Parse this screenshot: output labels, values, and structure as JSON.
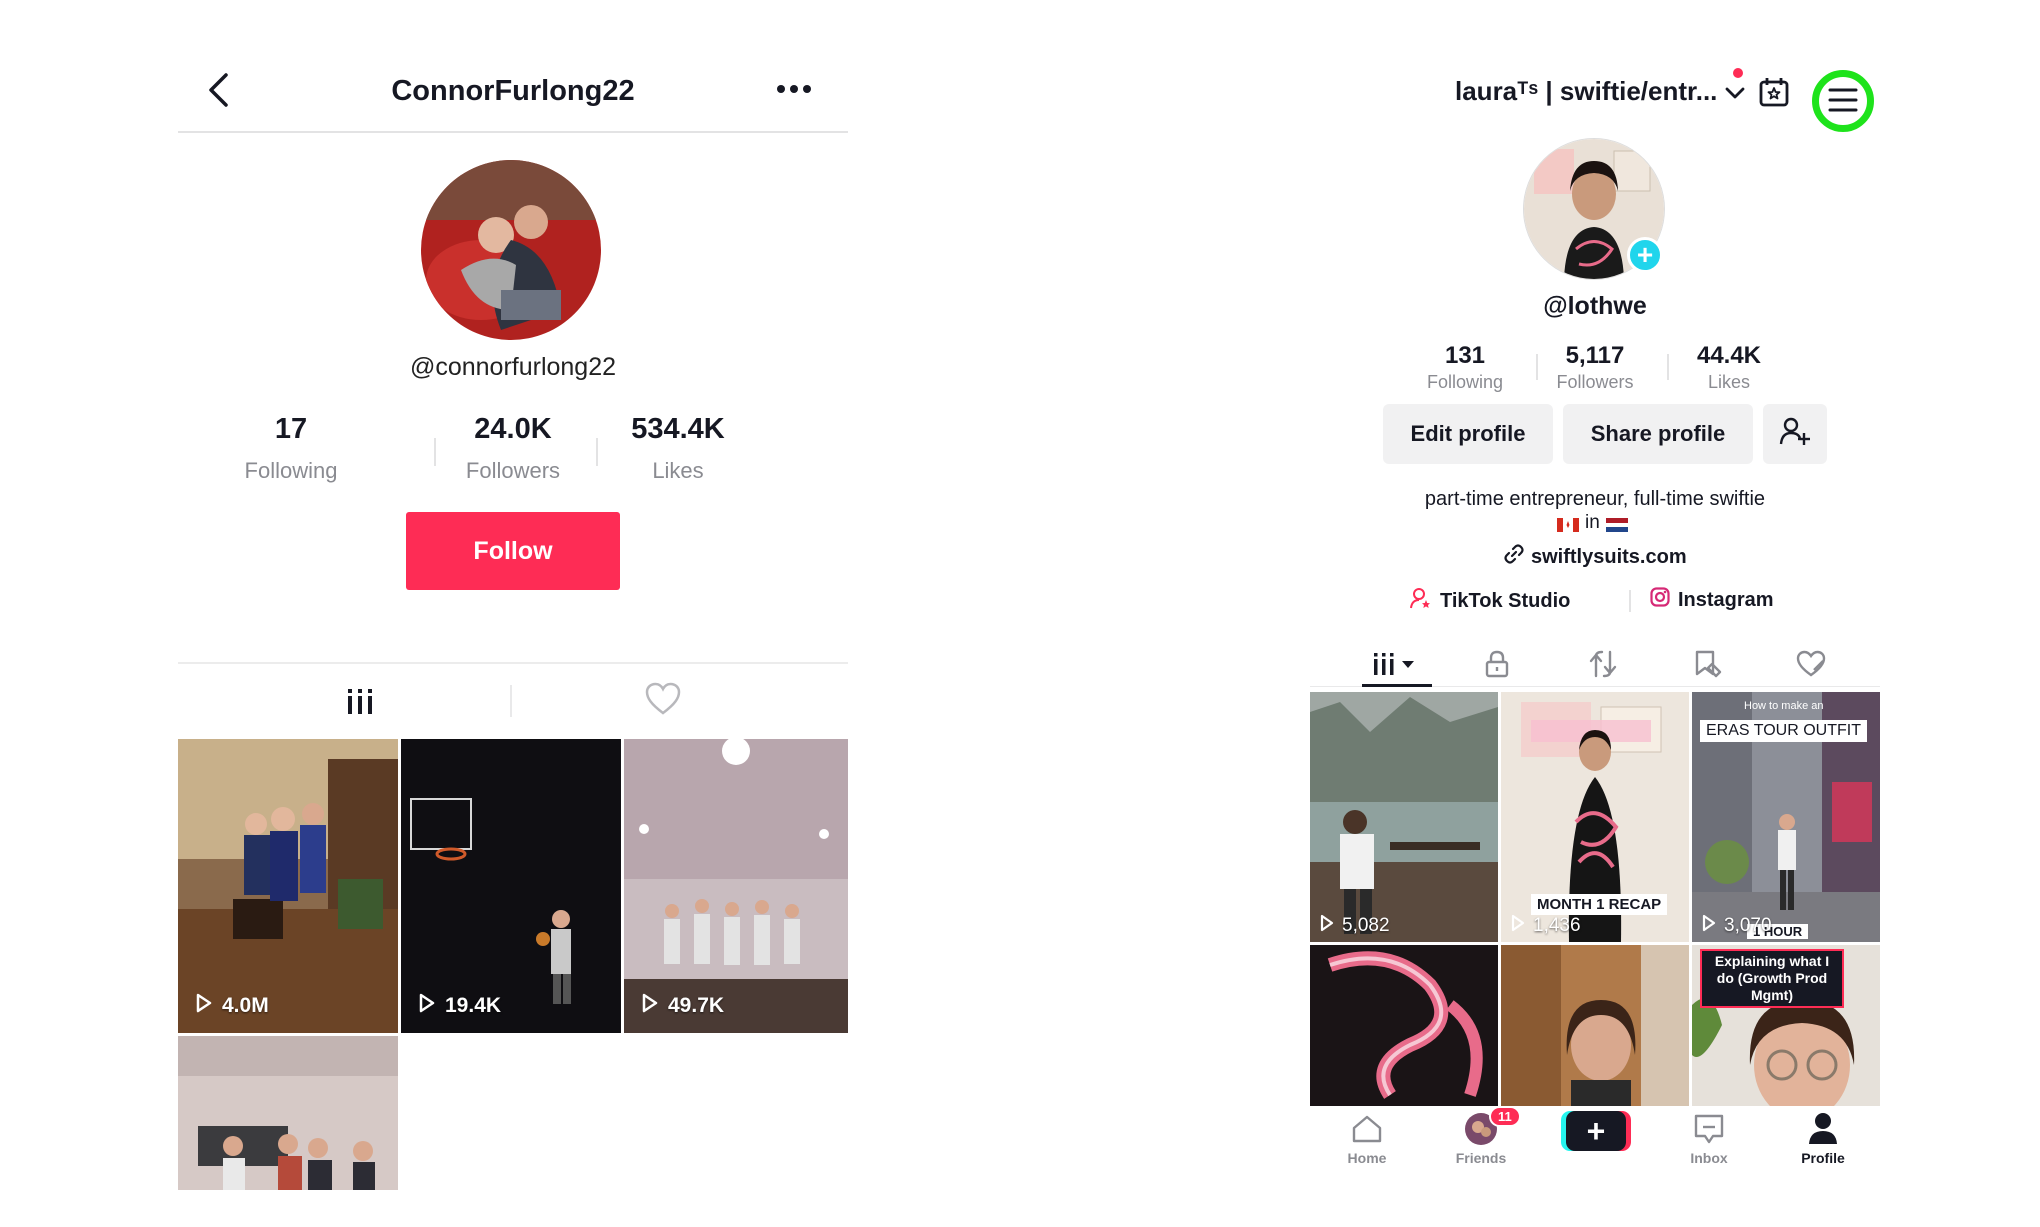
{
  "left_profile": {
    "title": "ConnorFurlong22",
    "handle": "@connorfurlong22",
    "stats": [
      {
        "value": "17",
        "label": "Following"
      },
      {
        "value": "24.0K",
        "label": "Followers"
      },
      {
        "value": "534.4K",
        "label": "Likes"
      }
    ],
    "follow_label": "Follow",
    "tabs": [
      {
        "icon": "grid-icon"
      },
      {
        "icon": "heart-outline-icon"
      }
    ],
    "videos": [
      {
        "views": "4.0M"
      },
      {
        "views": "19.4K"
      },
      {
        "views": "49.7K"
      },
      {
        "views": ""
      }
    ]
  },
  "right_profile": {
    "account_name": "lauraᵀˢ | swiftie/entr...",
    "handle": "@lothwe",
    "stats": [
      {
        "value": "131",
        "label": "Following"
      },
      {
        "value": "5,117",
        "label": "Followers"
      },
      {
        "value": "44.4K",
        "label": "Likes"
      }
    ],
    "buttons": {
      "edit": "Edit profile",
      "share": "Share profile"
    },
    "bio": "part-time entrepreneur, full-time swiftie",
    "bio_line2": "in",
    "link": "swiftlysuits.com",
    "extra_links": [
      "TikTok Studio",
      "Instagram"
    ],
    "videos": [
      {
        "views": "5,082",
        "caption": ""
      },
      {
        "views": "1,436",
        "caption": "MONTH 1 RECAP"
      },
      {
        "views": "3,070",
        "caption": "ERAS TOUR OUTFIT",
        "caption_small": "How to make an",
        "caption_bottom": "1 HOUR"
      },
      {
        "views": "",
        "caption": ""
      },
      {
        "views": "",
        "caption": ""
      },
      {
        "views": "",
        "caption": "Explaining what I do (Growth Prod Mgmt)"
      }
    ],
    "nav": {
      "home": "Home",
      "friends": "Friends",
      "friends_badge": "11",
      "inbox": "Inbox",
      "profile": "Profile"
    },
    "colors": {
      "highlight_ring": "#1ee31b",
      "accent": "#fe2c55",
      "plus": "#20d5ec"
    }
  }
}
